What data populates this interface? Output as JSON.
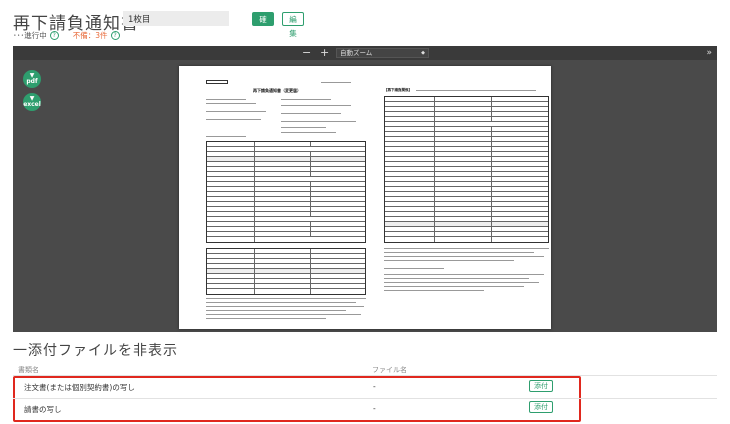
{
  "header": {
    "title": "再下請負通知書",
    "name_value": "1枚目",
    "confirm_label": "確定",
    "edit_label": "編集",
    "status_text": "･･･進行中",
    "ng_text": "不備：3件"
  },
  "viewer": {
    "zoom_minus": "−",
    "zoom_plus": "+",
    "zoom_value": "自動ズーム",
    "pdf_label": "pdf",
    "excel_label": "excel",
    "doc_left_title": "再下請負通知書（変更届）",
    "doc_right_title": "【再下請負関係】"
  },
  "attachments": {
    "title": "一添付ファイルを非表示",
    "col_name": "書類名",
    "col_file": "ファイル名",
    "rows": [
      {
        "name": "注文書(または個別契約書)の写し",
        "file": "-",
        "button": "添付"
      },
      {
        "name": "請書の写し",
        "file": "-",
        "button": "添付"
      }
    ]
  },
  "colors": {
    "accent": "#2e9e6e",
    "warning": "#e86a3a",
    "highlight": "#e0281e"
  }
}
